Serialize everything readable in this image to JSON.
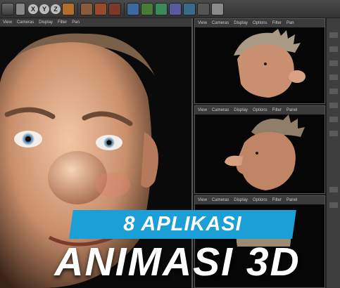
{
  "toolbar": {
    "axis_buttons": [
      "X",
      "Y",
      "Z"
    ]
  },
  "main_viewport": {
    "menu": [
      "View",
      "Cameras",
      "Display",
      "Filter",
      "Pan"
    ]
  },
  "side_viewports": [
    {
      "menu": [
        "View",
        "Cameras",
        "Display",
        "Options",
        "Filter",
        "Pan"
      ]
    },
    {
      "menu": [
        "View",
        "Cameras",
        "Display",
        "Options",
        "Filter",
        "Panel"
      ]
    },
    {
      "menu": [
        "View",
        "Cameras",
        "Display",
        "Options",
        "Filter",
        "Panel"
      ]
    }
  ],
  "overlay": {
    "line1": "8 APLIKASI",
    "line2": "ANIMASI 3D",
    "accent_color": "#1a9fd6"
  }
}
